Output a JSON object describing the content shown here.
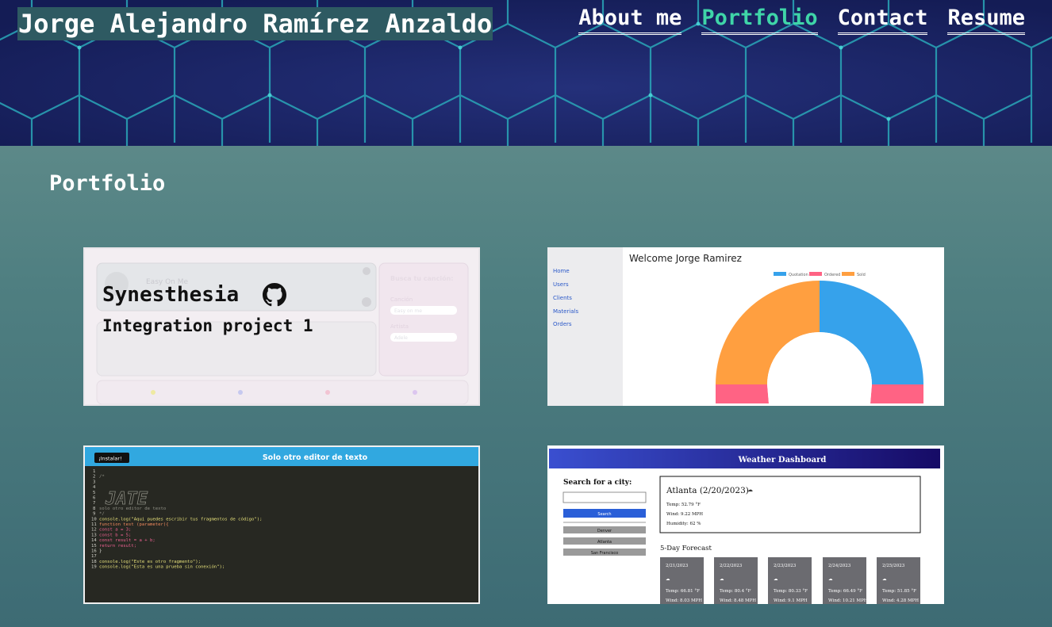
{
  "header": {
    "title": "Jorge Alejandro Ramírez Anzaldo",
    "nav": [
      {
        "label": "About me",
        "active": false
      },
      {
        "label": "Portfolio",
        "active": true
      },
      {
        "label": "Contact",
        "active": false
      },
      {
        "label": "Resume",
        "active": false
      }
    ]
  },
  "portfolio": {
    "heading": "Portfolio",
    "projects": [
      {
        "name": "Synesthesia",
        "description": "Integration project 1",
        "icon": "github-icon",
        "screenshot": {
          "player_title": "Easy On Me",
          "search_heading": "Busca tu canción:",
          "field1_label": "Canción",
          "field1_value": "Easy on me",
          "field2_label": "Artista",
          "field2_value": "Adele"
        }
      },
      {
        "screenshot": {
          "welcome": "Welcome Jorge Ramirez",
          "sidebar": [
            "Home",
            "Users",
            "Clients",
            "Materials",
            "Orders"
          ],
          "legend": [
            "Quotation",
            "Ordered",
            "Sold"
          ],
          "colors": {
            "blue": "#36a2eb",
            "pink": "#ff6384",
            "orange": "#ff9f40"
          }
        }
      },
      {
        "screenshot": {
          "install_button": "¡Instalar!",
          "title": "Solo otro editor de texto",
          "lines": [
            "/*",
            "",
            "",
            "",
            "",
            "",
            "",
            "solo otro editor de texto",
            "*/",
            "console.log(\"Aqui puedes escribir tus fragmentos de código\");",
            "function test (parameter){",
            "  const a = 3;",
            "  const b = 5;",
            "  const result = a + b;",
            "  return result;",
            "}",
            "",
            "console.log(\"Este es otro fragmento\");",
            "console.log(\"Esta es una prueba sin conexión\");"
          ]
        }
      },
      {
        "screenshot": {
          "title": "Weather Dashboard",
          "search_label": "Search for a city:",
          "search_button": "Search",
          "history": [
            "Denver",
            "Atlanta",
            "San Francisco"
          ],
          "current_city": "Atlanta (2/20/2023)",
          "current_temp": "Temp: 52.79 °F",
          "current_wind": "Wind: 9.22 MPH",
          "current_humidity": "Humidity: 62 %",
          "forecast_heading": "5-Day Forecast",
          "forecast": [
            {
              "date": "2/21/2023",
              "temp": "Temp: 66.81 °F",
              "wind": "Wind: 8.03 MPH"
            },
            {
              "date": "2/22/2023",
              "temp": "Temp: 80.4 °F",
              "wind": "Wind: 8.48 MPH"
            },
            {
              "date": "2/23/2023",
              "temp": "Temp: 80.33 °F",
              "wind": "Wind: 9.1 MPH"
            },
            {
              "date": "2/24/2023",
              "temp": "Temp: 66.49 °F",
              "wind": "Wind: 10.21 MPH"
            },
            {
              "date": "2/25/2023",
              "temp": "Temp: 51.85 °F",
              "wind": "Wind: 4.28 MPH"
            }
          ]
        }
      }
    ]
  },
  "colors": {
    "hero_bg": "#1a2466",
    "hex_lines": "#2aa7b8",
    "nav_active": "#3fd5a8",
    "title_bg": "#2e5a62"
  }
}
